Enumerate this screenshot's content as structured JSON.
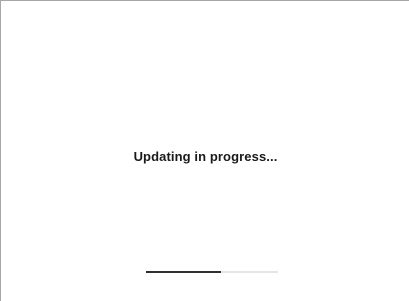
{
  "status": {
    "message": "Updating in progress..."
  },
  "progress": {
    "fraction": 0.57
  },
  "colors": {
    "track": "#e6e6e6",
    "fill": "#2f2f2f",
    "text": "#1a1a1a"
  }
}
